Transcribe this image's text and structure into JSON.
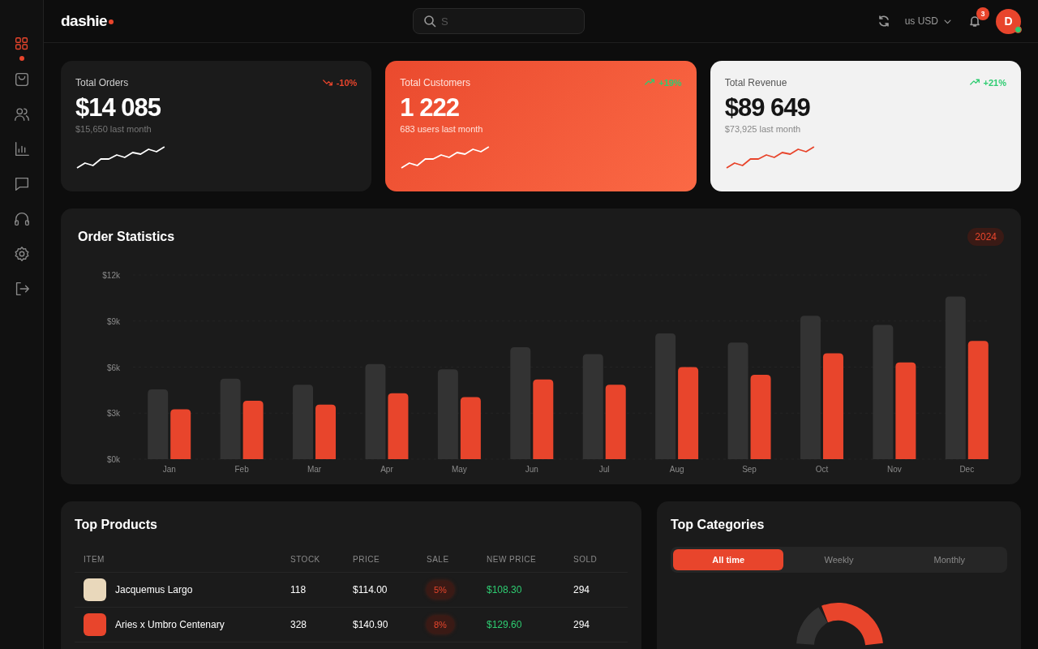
{
  "header": {
    "logo": "dashie",
    "search": {
      "placeholder": "S"
    },
    "currency": {
      "flag": "us",
      "code": "USD"
    },
    "notifications": {
      "count": "3"
    },
    "avatar": {
      "initial": "D",
      "online": true
    }
  },
  "sidebar": {
    "items": [
      {
        "selected": true
      },
      {
        "selected": false
      },
      {
        "selected": false
      },
      {
        "selected": false
      },
      {
        "selected": false
      },
      {
        "selected": false
      },
      {
        "selected": false
      },
      {
        "selected": false
      }
    ]
  },
  "stats": [
    {
      "kind": "dark",
      "title": "Total Orders",
      "value": "$14 085",
      "subtitle": "$15,650 last month",
      "change": {
        "text": "-10%",
        "kind": "down"
      }
    },
    {
      "kind": "accent",
      "title": "Total Customers",
      "value": "1 222",
      "subtitle": "683 users last month",
      "change": {
        "text": "+19%",
        "kind": "up"
      }
    },
    {
      "kind": "light",
      "title": "Total Revenue",
      "value": "$89 649",
      "subtitle": "$73,925 last month",
      "change": {
        "text": "+21%",
        "kind": "up"
      }
    }
  ],
  "order_statistics": {
    "title": "Order Statistics",
    "year": "2024",
    "chart_data": {
      "type": "bar",
      "categories": [
        "Jan",
        "Feb",
        "Mar",
        "Apr",
        "May",
        "Jun",
        "Jul",
        "Aug",
        "Sep",
        "Oct",
        "Nov",
        "Dec"
      ],
      "series": [
        {
          "color": "#333333",
          "values": [
            4550,
            5250,
            4850,
            6200,
            5850,
            7300,
            6850,
            8200,
            7600,
            9350,
            8750,
            10600
          ]
        },
        {
          "color": "#e8452c",
          "values": [
            3250,
            3800,
            3550,
            4300,
            4050,
            5200,
            4850,
            6000,
            5500,
            6900,
            6300,
            7700
          ]
        }
      ],
      "ylim": [
        0,
        12000
      ],
      "grid": true,
      "yticks": [
        {
          "value": 0,
          "label": "$0k"
        },
        {
          "value": 3000,
          "label": "$3k"
        },
        {
          "value": 6000,
          "label": "$6k"
        },
        {
          "value": 9000,
          "label": "$9k"
        },
        {
          "value": 12000,
          "label": "$12k"
        }
      ]
    }
  },
  "top_products": {
    "title": "Top Products",
    "columns": [
      "ITEM",
      "STOCK",
      "PRICE",
      "SALE",
      "NEW PRICE",
      "SOLD"
    ],
    "rows": [
      {
        "item": "Jacquemus Largo",
        "color": "#e9d8bb",
        "stock": "118",
        "price": "$114.00",
        "sale": "5%",
        "new_price": "$108.30",
        "sold": "294"
      },
      {
        "item": "Aries x Umbro Centenary",
        "color": "#e8452c",
        "stock": "328",
        "price": "$140.90",
        "sale": "8%",
        "new_price": "$129.60",
        "sold": "294"
      }
    ]
  },
  "top_categories": {
    "title": "Top Categories",
    "tabs": [
      {
        "label": "All time",
        "selected": true
      },
      {
        "label": "Weekly",
        "selected": false
      },
      {
        "label": "Monthly",
        "selected": false
      }
    ]
  }
}
